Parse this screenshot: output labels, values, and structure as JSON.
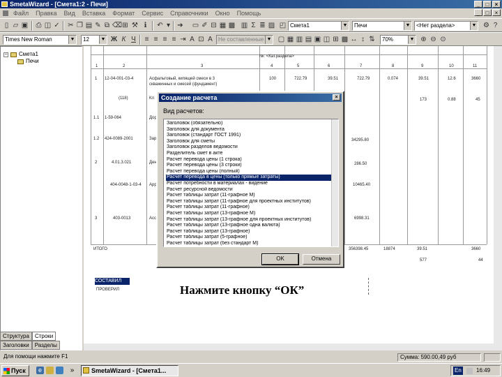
{
  "window": {
    "title": "SmetaWizard - [Смета1:2 - Печи]",
    "controls": [
      "_",
      "□",
      "×"
    ]
  },
  "menu": {
    "items": [
      "Файл",
      "Правка",
      "Вид",
      "Вставка",
      "Формат",
      "Сервис",
      "Справочники",
      "Окно",
      "Помощь"
    ],
    "mdi_controls": [
      "_",
      "□",
      "×"
    ]
  },
  "toolbar1": {
    "doc_combo": "Смета1",
    "section_combo": "Печи",
    "filter_combo": "<Нет раздела>"
  },
  "toolbar2": {
    "font_combo": "Times New Roman",
    "size_combo": "12",
    "bold": "Ж",
    "italic": "К",
    "underline": "Ч",
    "style_combo": "Не составленные",
    "zoom_combo": "70%"
  },
  "tree": {
    "root": "Смета1",
    "child": "Печи",
    "expander": "−"
  },
  "left_tabs": {
    "row1": [
      "Структура",
      "Строки"
    ],
    "row2": [
      "Заголовки",
      "Разделы"
    ]
  },
  "document": {
    "header_cells": [
      "1",
      "2",
      "3",
      "4",
      "5",
      "6",
      "7",
      "8",
      "9",
      "10",
      "11"
    ],
    "section_title": "№: <Кат.раздела>",
    "rows": [
      {
        "n": "1",
        "code": "12-04-001-03-4",
        "desc": "Асфальтовый, кипящей смеси в 3",
        "desc2": "скважинных и смесей (фундамент)",
        "c4": "100",
        "c5": "722.79",
        "c6": "39.51",
        "c7": "722.79",
        "c8": "0.074",
        "c9": "39.51",
        "c10": "12.6",
        "c11": "3660"
      },
      {
        "n": "",
        "code": "(118)",
        "desc": "Кл",
        "c9": "173",
        "c10": "0.88",
        "c11": "45"
      },
      {
        "n": "1.1",
        "code": "1-59-064",
        "desc": "Дор"
      },
      {
        "n": "1.2",
        "code": "424-0089-2001",
        "desc": "Зар",
        "c7": "34295.80"
      },
      {
        "n": "2",
        "code": "4.01.3.021",
        "desc": "Ден",
        "c7": "286.50"
      },
      {
        "n": "",
        "code": "404-0048-1-03-4",
        "desc": "Арр",
        "c7": "10465.40"
      },
      {
        "n": "3",
        "code": "403-0013",
        "desc": "Асс",
        "c7": "6998.31"
      }
    ],
    "total_label": "ИТОГО",
    "total_vals": [
      "356398.45",
      "18874",
      "39.51",
      "3660"
    ],
    "total_vals2": [
      "577",
      "44"
    ],
    "highlight": "СОСТАВИЛ",
    "checked": "ПРОВЕРИЛ"
  },
  "dialog": {
    "title": "Создание расчета",
    "close": "×",
    "label": "Вид расчетов:",
    "items": [
      "Заголовок (обязательно)",
      "Заголовок для документа",
      "Заголовок (стандарт ГОСТ 1991)",
      "Заголовок для сметы",
      "Заголовок разделов ведомости",
      "Разделитель смет в акте",
      "Расчет перевода цены (1 строка)",
      "Расчет перевода цены (3 строки)",
      "Расчет перевода цены (полный)",
      "Расчет перевода в цены (только прямые затраты)",
      "Расчет потребности в материалах - видение",
      "Расчет ресурсной ведомости",
      "Расчет таблицы затрат (11-графное М)",
      "Расчет таблицы затрат (11-графное для проектных институтов)",
      "Расчет таблицы затрат (11-графное)",
      "Расчет таблицы затрат (13-графное М)",
      "Расчет таблицы затрат (13-графное для проектных институтов)",
      "Расчет таблицы затрат (13-графное одна валюта)",
      "Расчет таблицы затрат (13-графное)",
      "Расчет таблицы затрат (5-графное)",
      "Расчет таблицы затрат (без стандарт М)"
    ],
    "selected_index": 9,
    "ok": "OK",
    "cancel": "Отмена"
  },
  "callout": "Нажмите кнопку “ОК”",
  "status": {
    "hint": "Для помощи нажмите F1",
    "sum": "Сумма: 590.00,49 руб"
  },
  "taskbar": {
    "start": "Пуск",
    "task": "SmetaWizard - [Смета1...",
    "lang": "En",
    "time": "16:49"
  }
}
